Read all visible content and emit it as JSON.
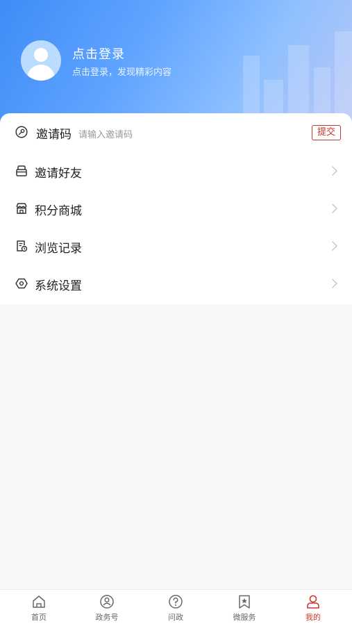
{
  "profile": {
    "login_title": "点击登录",
    "login_subtitle": "点击登录，发现精彩内容"
  },
  "invite": {
    "label": "邀请码",
    "placeholder": "请输入邀请码",
    "submit_label": "提交"
  },
  "menu": {
    "items": [
      {
        "label": "邀请好友",
        "icon": "invite-friend-icon"
      },
      {
        "label": "积分商城",
        "icon": "store-icon"
      },
      {
        "label": "浏览记录",
        "icon": "history-icon"
      },
      {
        "label": "系统设置",
        "icon": "settings-icon"
      }
    ]
  },
  "tabbar": {
    "items": [
      {
        "label": "首页",
        "icon": "home-icon"
      },
      {
        "label": "政务号",
        "icon": "gov-account-icon"
      },
      {
        "label": "问政",
        "icon": "question-icon"
      },
      {
        "label": "微服务",
        "icon": "star-bookmark-icon"
      },
      {
        "label": "我的",
        "icon": "user-icon",
        "active": true
      }
    ]
  },
  "colors": {
    "accent": "#d0342c",
    "header_blue": "#5fa4ff"
  }
}
